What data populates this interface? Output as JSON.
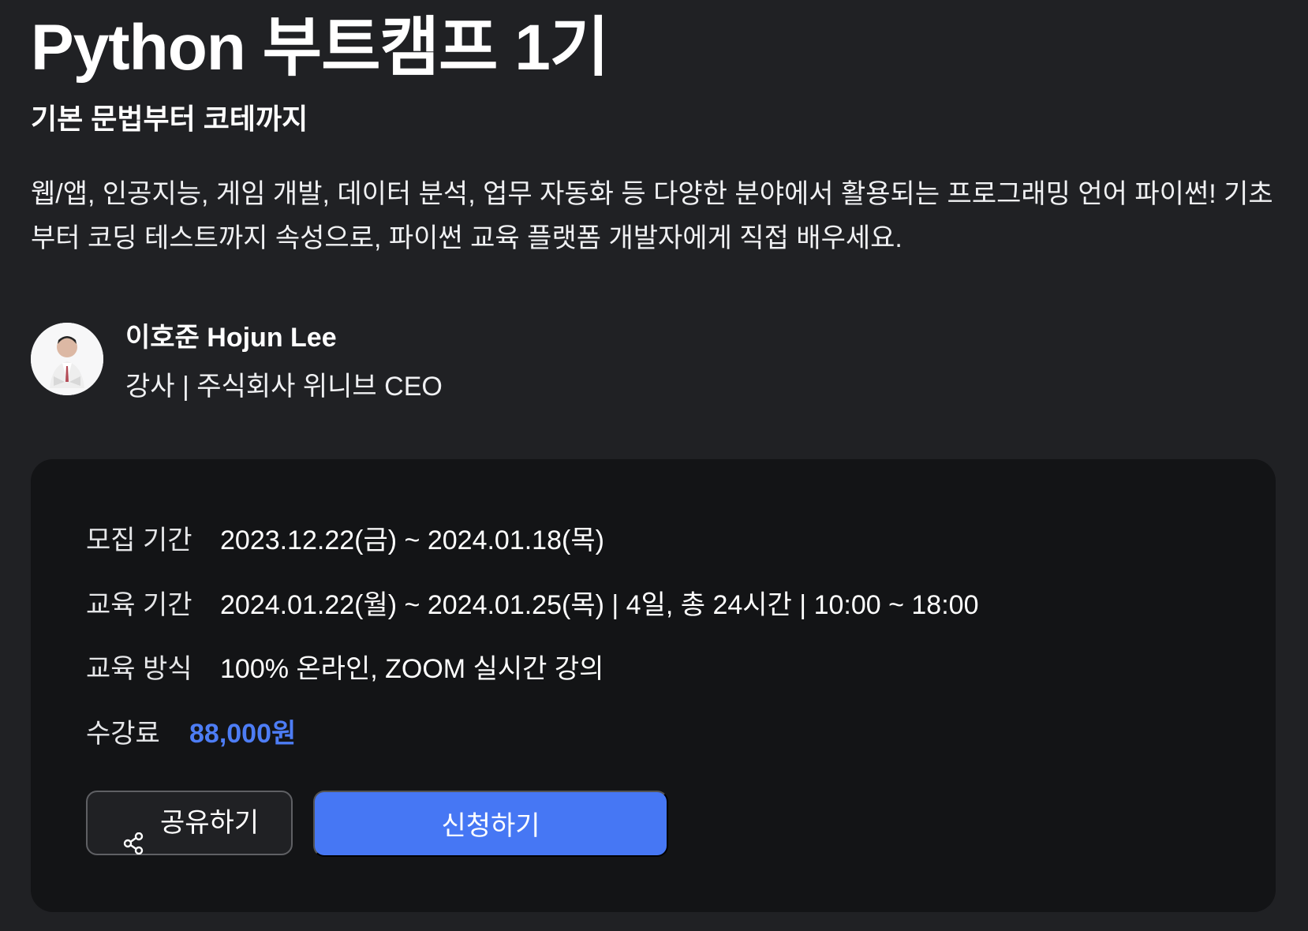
{
  "course": {
    "title": "Python 부트캠프 1기",
    "subtitle": "기본 문법부터 코테까지",
    "description": "웹/앱, 인공지능, 게임 개발, 데이터 분석, 업무 자동화 등 다양한 분야에서 활용되는 프로그래밍 언어 파이썬! 기초부터 코딩 테스트까지 속성으로, 파이썬 교육 플랫폼 개발자에게 직접 배우세요."
  },
  "instructor": {
    "name": "이호준 Hojun Lee",
    "role": "강사 | 주식회사 위니브 CEO",
    "avatar_icon": "instructor-avatar"
  },
  "details": {
    "recruitment_label": "모집 기간",
    "recruitment_value": "2023.12.22(금) ~ 2024.01.18(목)",
    "education_period_label": "교육 기간",
    "education_period_value": "2024.01.22(월) ~ 2024.01.25(목) | 4일, 총 24시간 | 10:00 ~ 18:00",
    "education_method_label": "교육 방식",
    "education_method_value": "100% 온라인, ZOOM 실시간 강의",
    "tuition_label": "수강료",
    "tuition_value": "88,000원"
  },
  "actions": {
    "share_label": "공유하기",
    "share_icon": "share-icon",
    "apply_label": "신청하기"
  },
  "colors": {
    "background": "#202124",
    "card": "#131416",
    "accent": "#4677f4",
    "price": "#4d7df5"
  }
}
